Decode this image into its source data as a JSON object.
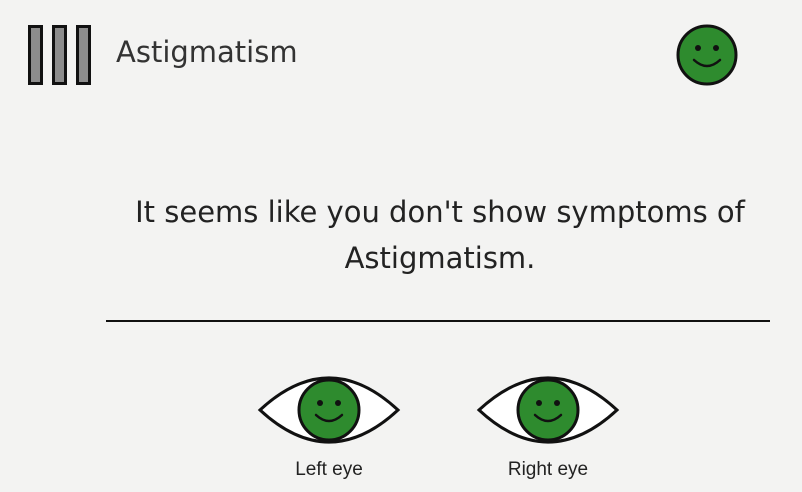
{
  "header": {
    "menu_icon": "menu-bars-icon",
    "title": "Astigmatism",
    "status_icon": "smiley-face-icon"
  },
  "result": {
    "message": "It seems like you don't show symptoms of Astigmatism."
  },
  "eyes": [
    {
      "label": "Left eye",
      "icon": "eye-icon",
      "status_icon": "smiley-face-icon"
    },
    {
      "label": "Right eye",
      "icon": "eye-icon",
      "status_icon": "smiley-face-icon"
    }
  ],
  "colors": {
    "background": "#f3f3f2",
    "success_green": "#2e8b2e",
    "bar_gray": "#8c8c8c",
    "text": "#222222"
  }
}
